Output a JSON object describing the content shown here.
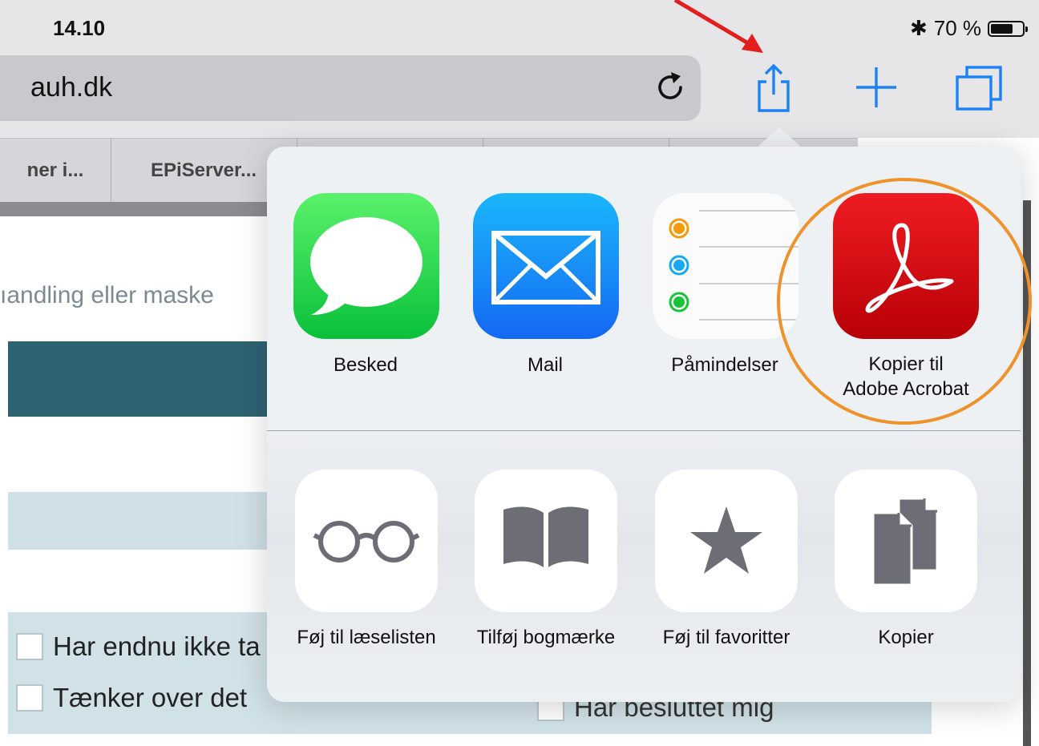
{
  "status": {
    "time": "14.10",
    "battery": "70 %",
    "battery_level": 0.7
  },
  "browser": {
    "url": "auh.dk",
    "tabs": [
      "ner i...",
      "EPiServer..."
    ]
  },
  "page": {
    "line": "ıandling eller maske",
    "options": [
      "Har endnu ikke ta",
      "Tænker over det",
      "Har besluttet mig"
    ]
  },
  "share": {
    "apps": [
      {
        "label": "Besked",
        "icon": "messages-icon"
      },
      {
        "label": "Mail",
        "icon": "mail-icon"
      },
      {
        "label": "Påmindelser",
        "icon": "reminders-icon"
      },
      {
        "label_line1": "Kopier til",
        "label_line2": "Adobe Acrobat",
        "icon": "adobe-acrobat-icon"
      }
    ],
    "actions": [
      {
        "label": "Føj til læselisten",
        "icon": "reading-list-icon"
      },
      {
        "label": "Tilføj bogmærke",
        "icon": "bookmark-icon"
      },
      {
        "label": "Føj til favoritter",
        "icon": "star-icon"
      },
      {
        "label": "Kopier",
        "icon": "copy-icon"
      }
    ]
  },
  "colors": {
    "ios_blue": "#1a82f5",
    "annotation_arrow": "#e41e1e",
    "annotation_circle": "#f0922b",
    "acrobat_red": "#e3161c",
    "messages_green": "#26d64c",
    "teal": "#2e6373"
  }
}
